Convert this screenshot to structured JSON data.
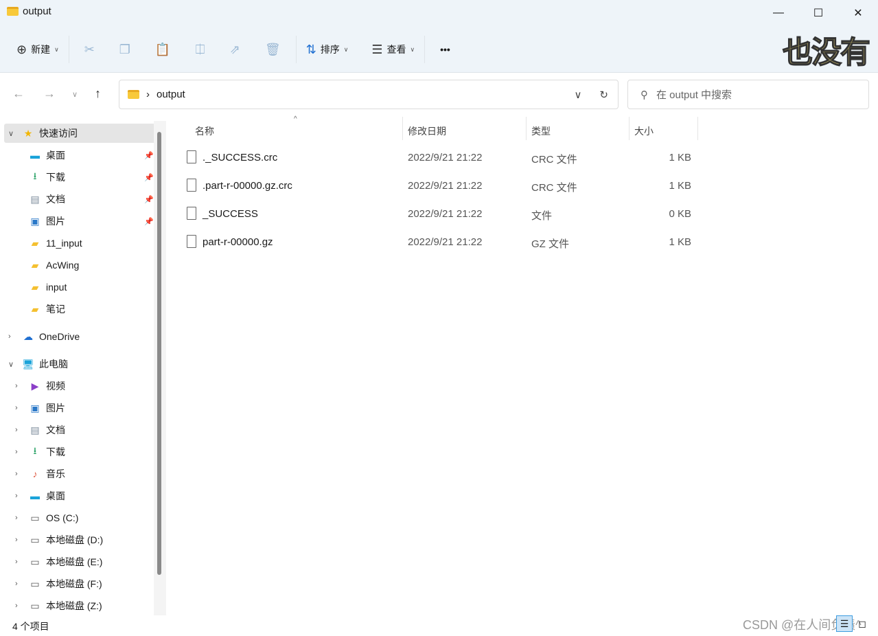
{
  "window": {
    "title": "output",
    "minimize": "—",
    "maximize": "☐",
    "close": "✕"
  },
  "toolbar": {
    "new_label": "新建",
    "sort_label": "排序",
    "view_label": "查看",
    "more": "•••",
    "overlay_text": "也没有"
  },
  "nav": {
    "path": "output",
    "separator": "›",
    "search_placeholder": "在 output 中搜索"
  },
  "columns": [
    "名称",
    "修改日期",
    "类型",
    "大小"
  ],
  "files": [
    {
      "name": "._SUCCESS.crc",
      "date": "2022/9/21 21:22",
      "type": "CRC 文件",
      "size": "1 KB"
    },
    {
      "name": ".part-r-00000.gz.crc",
      "date": "2022/9/21 21:22",
      "type": "CRC 文件",
      "size": "1 KB"
    },
    {
      "name": "_SUCCESS",
      "date": "2022/9/21 21:22",
      "type": "文件",
      "size": "0 KB"
    },
    {
      "name": "part-r-00000.gz",
      "date": "2022/9/21 21:22",
      "type": "GZ 文件",
      "size": "1 KB"
    }
  ],
  "sidebar": [
    {
      "label": "快速访问",
      "icon": "star-icon",
      "level": 0,
      "expanded": true,
      "selected": true
    },
    {
      "label": "桌面",
      "icon": "desktop-icon",
      "level": 1,
      "pinned": true
    },
    {
      "label": "下载",
      "icon": "download-icon",
      "level": 1,
      "pinned": true
    },
    {
      "label": "文档",
      "icon": "document-icon",
      "level": 1,
      "pinned": true
    },
    {
      "label": "图片",
      "icon": "pictures-icon",
      "level": 1,
      "pinned": true
    },
    {
      "label": "11_input",
      "icon": "folder-icon",
      "level": 1
    },
    {
      "label": "AcWing",
      "icon": "folder-icon",
      "level": 1
    },
    {
      "label": "input",
      "icon": "folder-icon",
      "level": 1
    },
    {
      "label": "笔记",
      "icon": "folder-icon",
      "level": 1
    },
    {
      "label": "OneDrive",
      "icon": "cloud-icon",
      "level": 0,
      "expanded": false
    },
    {
      "label": "此电脑",
      "icon": "computer-icon",
      "level": 0,
      "expanded": true
    },
    {
      "label": "视频",
      "icon": "video-icon",
      "level": 1,
      "expandable": true
    },
    {
      "label": "图片",
      "icon": "pictures-icon",
      "level": 1,
      "expandable": true
    },
    {
      "label": "文档",
      "icon": "document-icon",
      "level": 1,
      "expandable": true
    },
    {
      "label": "下载",
      "icon": "download-icon",
      "level": 1,
      "expandable": true
    },
    {
      "label": "音乐",
      "icon": "music-icon",
      "level": 1,
      "expandable": true
    },
    {
      "label": "桌面",
      "icon": "desktop-icon",
      "level": 1,
      "expandable": true
    },
    {
      "label": "OS (C:)",
      "icon": "drive-icon",
      "level": 1,
      "expandable": true
    },
    {
      "label": "本地磁盘 (D:)",
      "icon": "drive-icon",
      "level": 1,
      "expandable": true
    },
    {
      "label": "本地磁盘 (E:)",
      "icon": "drive-icon",
      "level": 1,
      "expandable": true
    },
    {
      "label": "本地磁盘 (F:)",
      "icon": "drive-icon",
      "level": 1,
      "expandable": true
    },
    {
      "label": "本地磁盘 (Z:)",
      "icon": "drive-icon",
      "level": 1,
      "expandable": true
    }
  ],
  "status": {
    "count": "4 个项目"
  },
  "watermark": "CSDN @在人间负债^"
}
